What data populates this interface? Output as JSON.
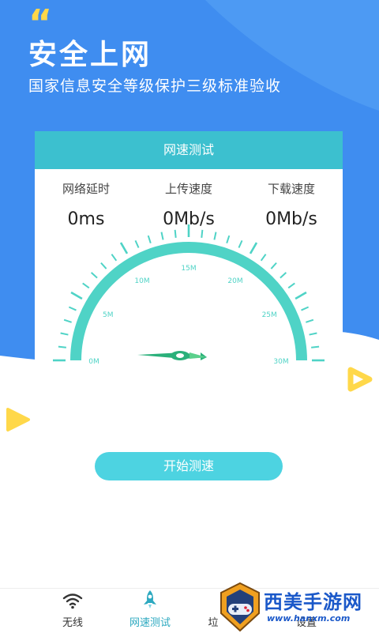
{
  "hero": {
    "quote_mark": "“",
    "title": "安全上网",
    "subtitle": "国家信息安全等级保护三级标准验收",
    "bg_color": "#3f8df0"
  },
  "card": {
    "header": "网速测试",
    "metrics": [
      {
        "label": "网络延时",
        "value": "0ms"
      },
      {
        "label": "上传速度",
        "value": "0Mb/s"
      },
      {
        "label": "下载速度",
        "value": "0Mb/s"
      }
    ]
  },
  "gauge": {
    "min_label": "0M",
    "max_label": "30M",
    "tick_labels": [
      "0M",
      "5M",
      "10M",
      "15M",
      "20M",
      "25M",
      "30M"
    ],
    "current_value": 0,
    "arc_color": "#4fd3c6",
    "tick_color": "#4fd3c6"
  },
  "actions": {
    "start_label": "开始测速"
  },
  "tabbar": {
    "tabs": [
      {
        "label": "无线",
        "icon": "wifi-icon",
        "active": false
      },
      {
        "label": "网速测试",
        "icon": "rocket-icon",
        "active": true
      },
      {
        "label": "垃",
        "icon": "broom-icon",
        "active": false
      },
      {
        "label": "设置",
        "icon": "settings-icon",
        "active": false
      }
    ]
  },
  "watermark": {
    "brand": "西美手游网",
    "url": "www.hanxm.com"
  },
  "colors": {
    "accent": "#3cc0cf",
    "button": "#4dd3e1",
    "play_yellow": "#ffd84a"
  }
}
